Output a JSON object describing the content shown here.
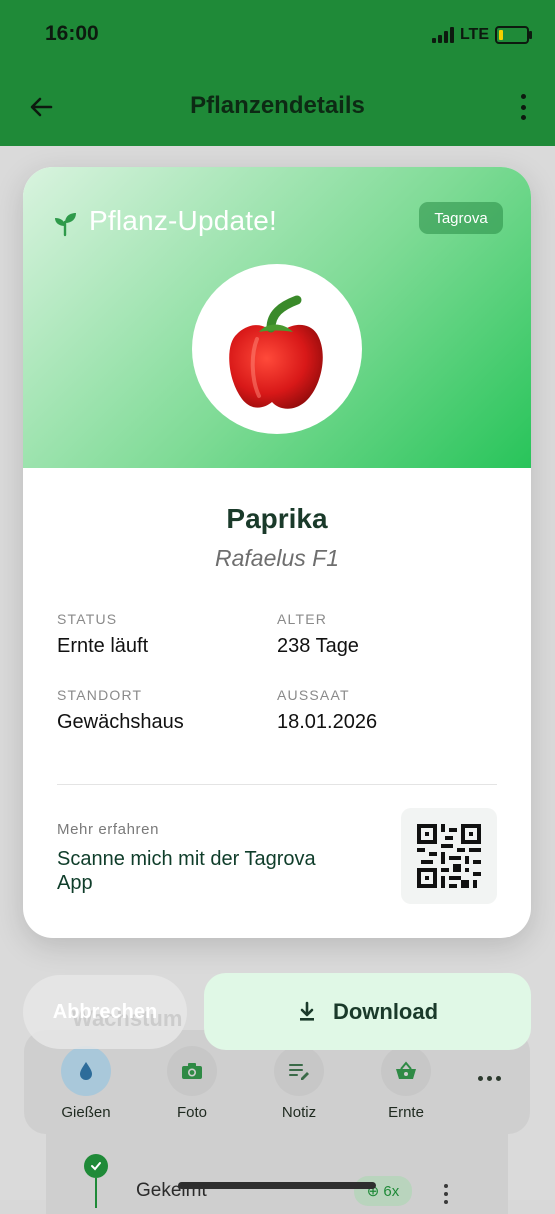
{
  "status_bar": {
    "time": "16:00",
    "network": "LTE"
  },
  "app_bar": {
    "title": "Pflanzendetails"
  },
  "card": {
    "update_title": "Pflanz-Update!",
    "brand_badge": "Tagrova",
    "plant_name": "Paprika",
    "variety": "Rafaelus F1",
    "fields": {
      "status_label": "STATUS",
      "status_value": "Ernte läuft",
      "age_label": "ALTER",
      "age_value": "238 Tage",
      "location_label": "STANDORT",
      "location_value": "Gewächshaus",
      "sowing_label": "AUSSAAT",
      "sowing_value": "18.01.2026"
    },
    "more_label": "Mehr erfahren",
    "scan_text": "Scanne mich mit der Tagrova App"
  },
  "buttons": {
    "cancel": "Abbrechen",
    "download": "Download"
  },
  "background": {
    "actions": [
      {
        "label": "Gießen",
        "icon": "water-drop-icon"
      },
      {
        "label": "Foto",
        "icon": "camera-icon"
      },
      {
        "label": "Notiz",
        "icon": "note-icon"
      },
      {
        "label": "Ernte",
        "icon": "basket-icon"
      }
    ],
    "timeline_item": "Gekeimt",
    "timeline_badge": "6x"
  },
  "colors": {
    "primary": "#1f8a38",
    "header_gradient_end": "#28c45a",
    "download_bg": "#e0f8e6"
  }
}
